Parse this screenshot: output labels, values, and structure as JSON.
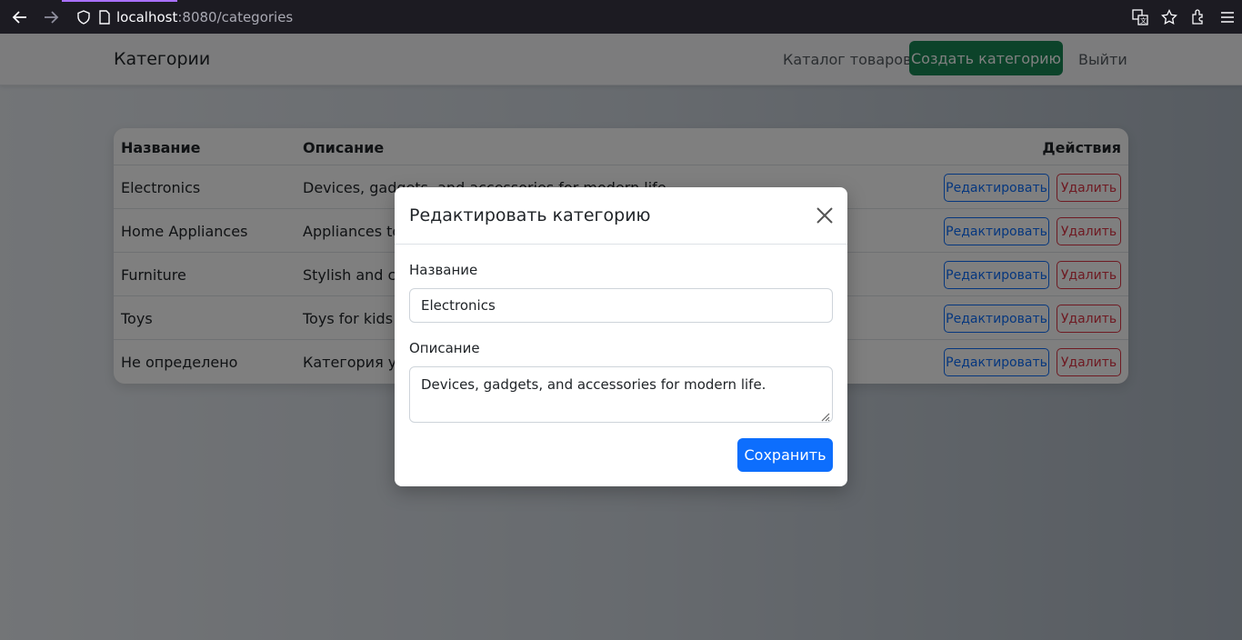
{
  "browser": {
    "url_host": "localhost",
    "url_path": ":8080/categories"
  },
  "navbar": {
    "brand": "Категории",
    "catalog_link": "Каталог товаров",
    "create_button": "Создать категорию",
    "logout_link": "Выйти"
  },
  "table": {
    "headers": {
      "name": "Название",
      "description": "Описание",
      "actions": "Действия"
    },
    "rows": [
      {
        "name": "Electronics",
        "description": "Devices, gadgets, and accessories for modern life.",
        "edit": "Редактировать",
        "delete": "Удалить"
      },
      {
        "name": "Home Appliances",
        "description": "Appliances to",
        "edit": "Редактировать",
        "delete": "Удалить"
      },
      {
        "name": "Furniture",
        "description": "Stylish and cor",
        "edit": "Редактировать",
        "delete": "Удалить"
      },
      {
        "name": "Toys",
        "description": "Toys for kids o",
        "edit": "Редактировать",
        "delete": "Удалить"
      },
      {
        "name": "Не определено",
        "description": "Категория уда",
        "edit": "Редактировать",
        "delete": "Удалить"
      }
    ]
  },
  "modal": {
    "title": "Редактировать категорию",
    "name_label": "Название",
    "name_value": "Electronics",
    "description_label": "Описание",
    "description_value": "Devices, gadgets, and accessories for modern life.",
    "save_button": "Сохранить"
  },
  "colors": {
    "primary": "#0d6efd",
    "success": "#198754",
    "danger": "#dc3545"
  }
}
